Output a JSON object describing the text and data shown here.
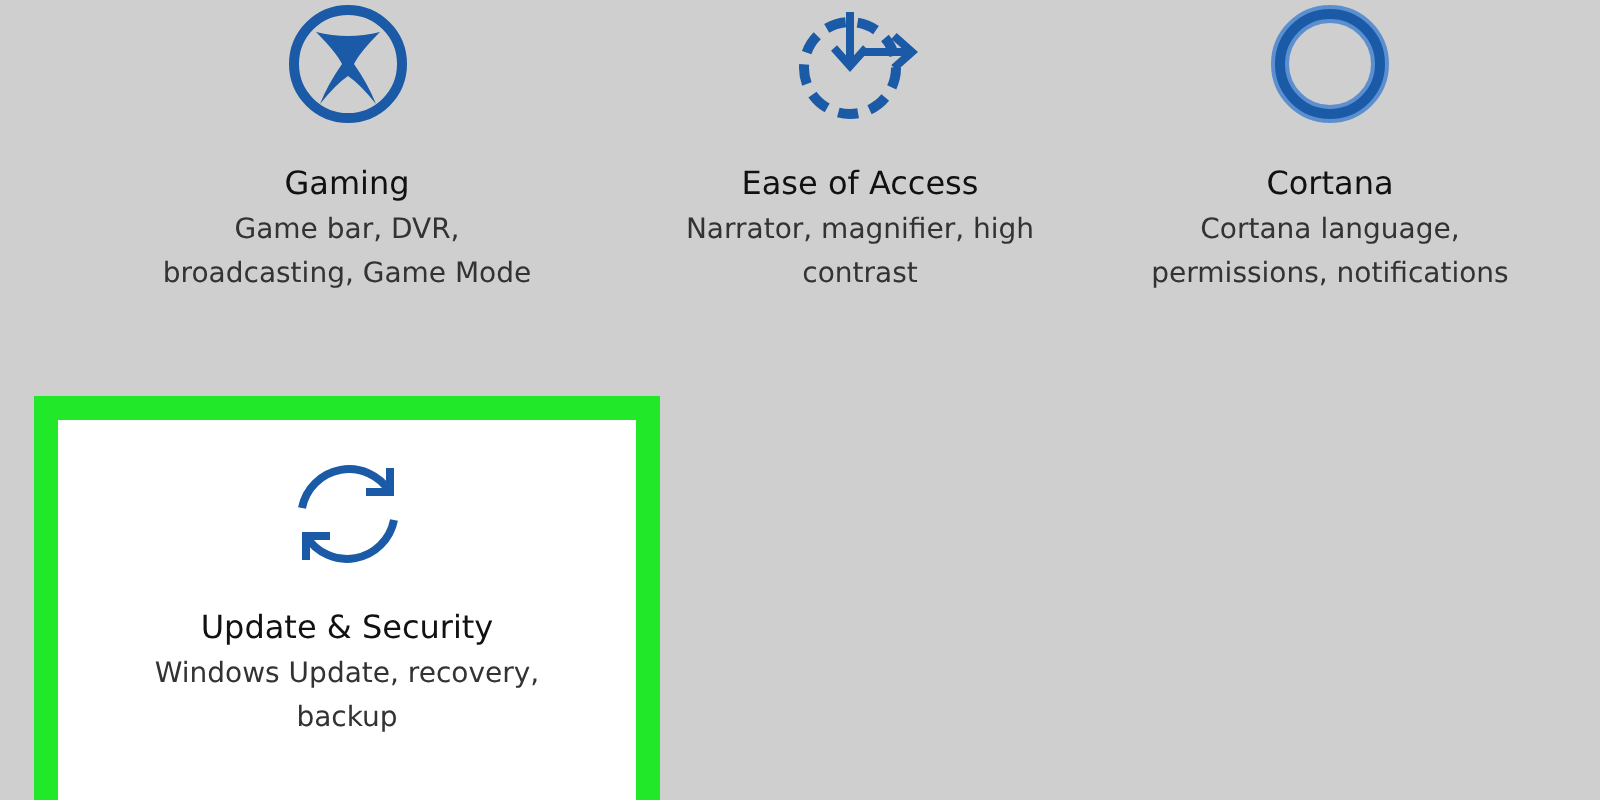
{
  "categories": [
    {
      "kind": "gaming",
      "title": "Gaming",
      "description": "Game bar, DVR, broadcasting, Game Mode",
      "highlighted": false
    },
    {
      "kind": "ease",
      "title": "Ease of Access",
      "description": "Narrator, magnifier, high contrast",
      "highlighted": false
    },
    {
      "kind": "cortana",
      "title": "Cortana",
      "description": "Cortana language, permissions, notifications",
      "highlighted": false
    },
    {
      "kind": "update",
      "title": "Update & Security",
      "description": "Windows Update, recovery, backup",
      "highlighted": true
    }
  ]
}
